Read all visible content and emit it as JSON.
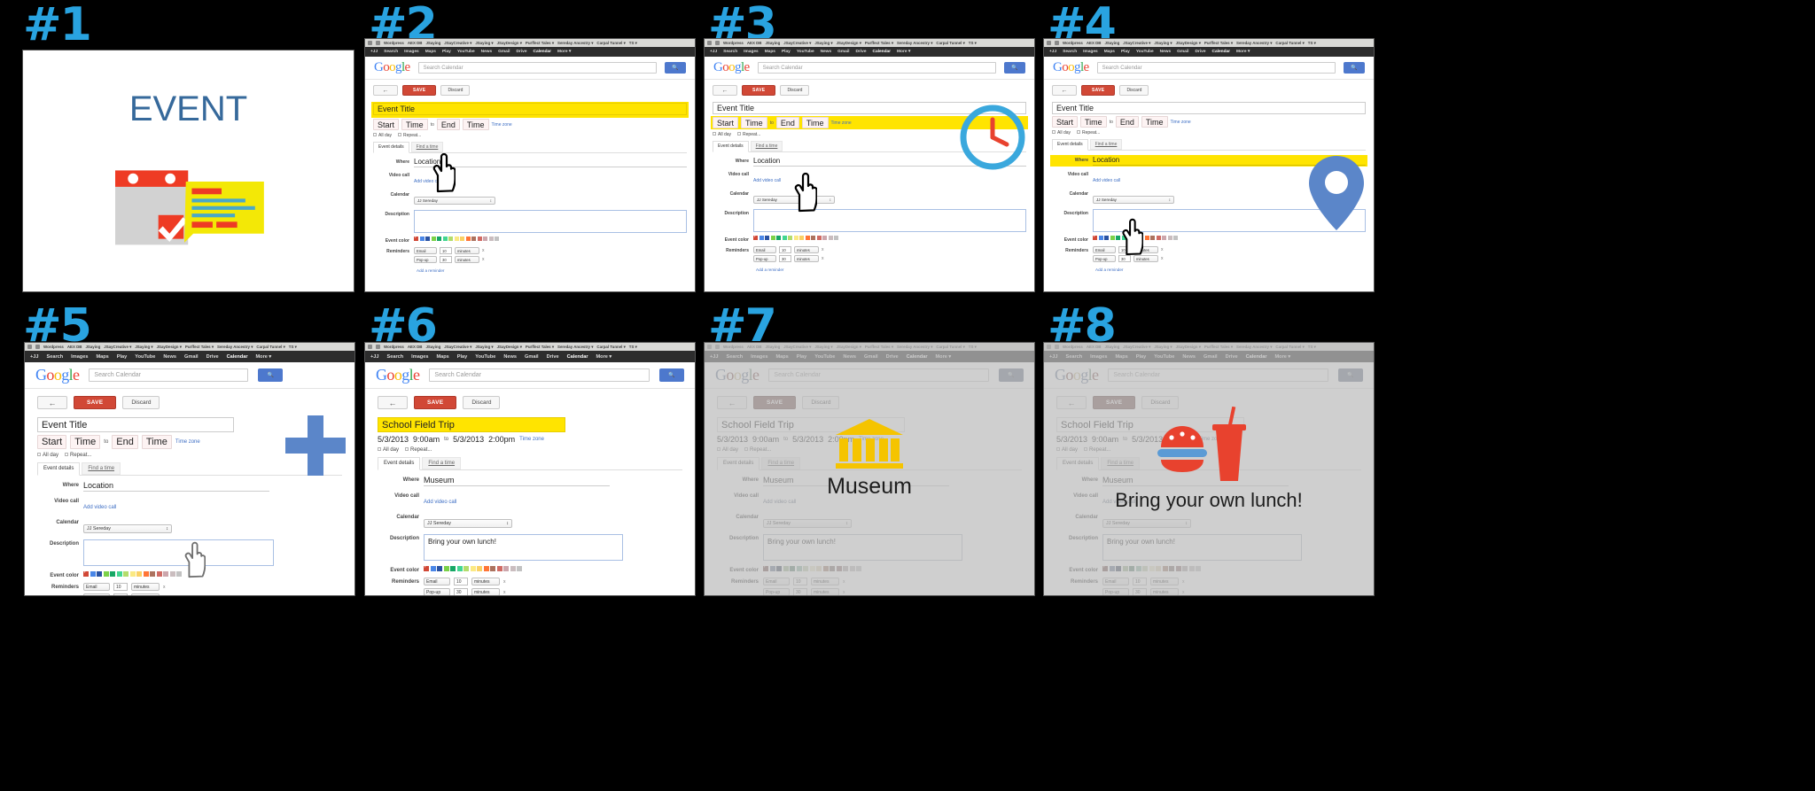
{
  "meta": {
    "panel_labels": [
      "#1",
      "#2",
      "#3",
      "#4",
      "#5",
      "#6",
      "#7",
      "#8"
    ],
    "accent_color": "#29a3e0",
    "highlight_color": "#ffe400",
    "save_color": "#d14836",
    "title_color": "#36699b"
  },
  "splash": {
    "title": "EVENT"
  },
  "browser": {
    "bookmarks": [
      "Wordpress",
      "AEX DB",
      "JSaying",
      "JSayCreative ▾",
      "JSaying ▾",
      "JSayDesign ▾",
      "Purffect Tales ▾",
      "Sereday Ancestry ▾",
      "Carpal Tunnel ▾",
      "TS ▾"
    ],
    "google_nav": [
      "+JJ",
      "Search",
      "Images",
      "Maps",
      "Play",
      "YouTube",
      "News",
      "Gmail",
      "Drive",
      "Calendar",
      "More ▾"
    ],
    "google_nav_active": "Calendar",
    "logo": "Google",
    "search_placeholder": "Search Calendar",
    "search_button_icon": "search-icon"
  },
  "form": {
    "back_icon": "back-arrow-icon",
    "save_label": "SAVE",
    "discard_label": "Discard",
    "title_placeholder": "Event Title",
    "start_date_placeholder": "Start",
    "start_time_placeholder": "Time",
    "to_label": "to",
    "end_date_placeholder": "End",
    "end_time_placeholder": "Time",
    "timezone_label": "Time zone",
    "all_day_label": "All day",
    "repeat_label": "Repeat...",
    "tab_event_details": "Event details",
    "tab_find_a_time": "Find a time",
    "where_label": "Where",
    "where_placeholder": "Location",
    "video_call_label": "Video call",
    "add_video_call_label": "Add video call",
    "calendar_label": "Calendar",
    "calendar_value": "JJ Sereday",
    "description_label": "Description",
    "description_placeholder": "",
    "event_color_label": "Event color",
    "reminders_label": "Reminders",
    "reminder_1_type": "Email",
    "reminder_1_num": "10",
    "reminder_1_unit": "minutes",
    "reminder_2_type": "Pop-up",
    "reminder_2_num": "30",
    "reminder_2_unit": "minutes",
    "add_reminder_label": "Add a reminder",
    "remove_label": "x",
    "color_swatches": [
      "#d14836",
      "#4986e7",
      "#2952a3",
      "#7bd148",
      "#16a765",
      "#42d692",
      "#b3dc6c",
      "#fbe983",
      "#fad165",
      "#ff7537",
      "#ac725e",
      "#d06b64",
      "#cca6ac",
      "#cabdbf",
      "#c2c2c2"
    ]
  },
  "filled": {
    "title": "School Field Trip",
    "start_date": "5/3/2013",
    "start_time": "9:00am",
    "to": "to",
    "end_date": "5/3/2013",
    "end_time": "2:00pm",
    "timezone_label": "Time zone",
    "where": "Museum",
    "description": "Bring your own lunch!"
  },
  "overlays": {
    "panel4_icon": "map-pin-icon",
    "panel3_icon": "clock-icon",
    "panel5_icon": "plus-icon",
    "panel7_icon": "museum-icon",
    "panel7_caption": "Museum",
    "panel8_icon": "lunch-icon",
    "panel8_caption": "Bring your own lunch!"
  }
}
